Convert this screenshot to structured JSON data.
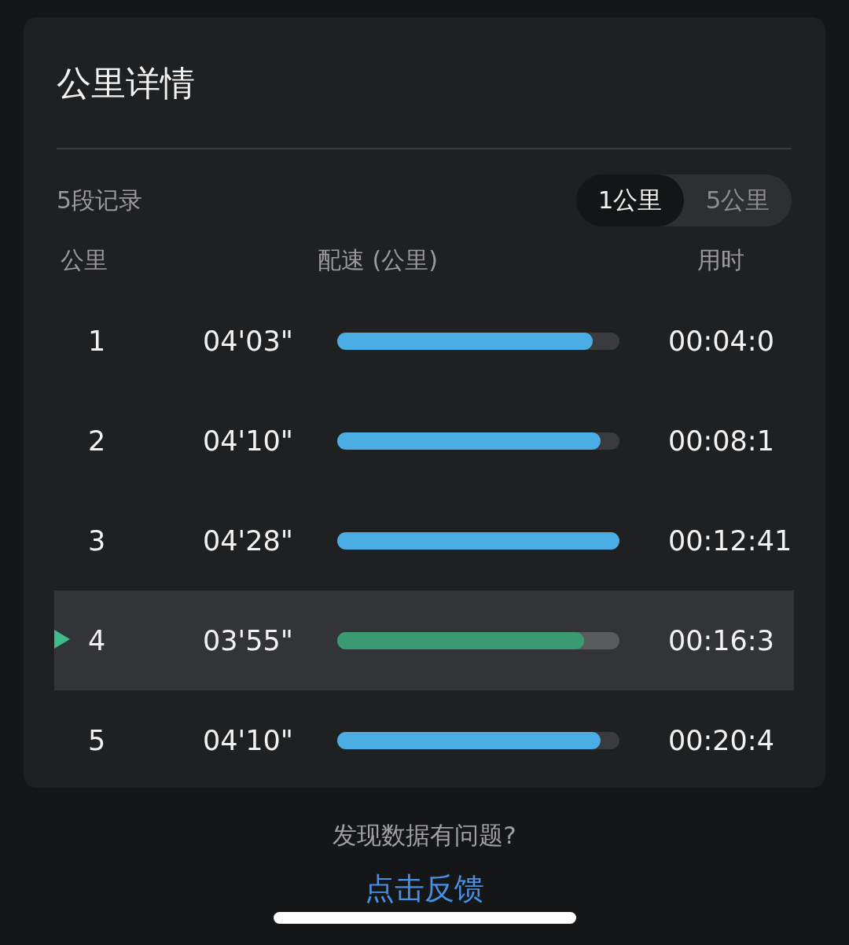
{
  "card": {
    "title": "公里详情",
    "record_count": "5段记录",
    "unit_toggle": [
      {
        "label": "1公里",
        "selected": true
      },
      {
        "label": "5公里",
        "selected": false
      }
    ],
    "columns": [
      "公里",
      "配速 (公里)",
      "用时"
    ],
    "rows": [
      {
        "km": "1",
        "pace": "04'03\"",
        "level": 0.905,
        "time": "00:04:0",
        "selected": false
      },
      {
        "km": "2",
        "pace": "04'10\"",
        "level": 0.933,
        "time": "00:08:1",
        "selected": false
      },
      {
        "km": "3",
        "pace": "04'28\"",
        "level": 1,
        "time": "00:12:41",
        "selected": false
      },
      {
        "km": "4",
        "pace": "03'55\"",
        "level": 0.875,
        "time": "00:16:3",
        "selected": true
      },
      {
        "km": "5",
        "pace": "04'10\"",
        "level": 0.933,
        "time": "00:20:4",
        "selected": false
      }
    ]
  },
  "footer": {
    "question": "发现数据有问题?",
    "link": "点击反馈"
  }
}
